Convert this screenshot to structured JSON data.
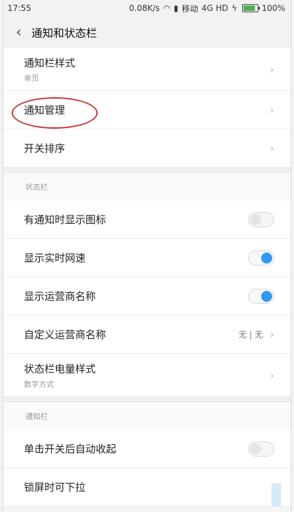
{
  "status_bar": {
    "time": "17:55",
    "speed": "0.08K/s",
    "carrier": "移动",
    "network": "4G HD",
    "battery": "100%"
  },
  "header": {
    "title": "通知和状态栏"
  },
  "notification_section": [
    {
      "title": "通知栏样式",
      "subtitle": "单页"
    },
    {
      "title": "通知管理"
    },
    {
      "title": "开关排序"
    }
  ],
  "status_bar_section": {
    "label": "状态栏",
    "items": [
      {
        "title": "有通知时显示图标",
        "state": "off"
      },
      {
        "title": "显示实时网速",
        "state": "on"
      },
      {
        "title": "显示运营商名称",
        "state": "on"
      },
      {
        "title": "自定义运营商名称",
        "value": "无 | 无"
      },
      {
        "title": "状态栏电量样式",
        "subtitle": "数字方式"
      }
    ]
  },
  "notification_bar_section": {
    "label": "通知栏",
    "items": [
      {
        "title": "单击开关后自动收起",
        "state": "off"
      },
      {
        "title": "锁屏时可下拉"
      }
    ]
  }
}
